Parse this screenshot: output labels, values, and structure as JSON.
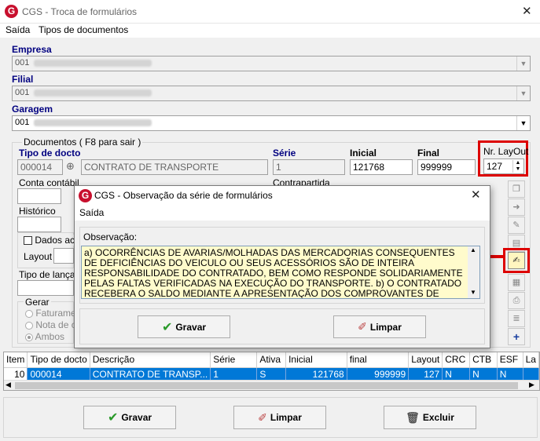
{
  "window": {
    "title": "CGS - Troca de formulários"
  },
  "menu": {
    "saida": "Saída",
    "tipos": "Tipos de documentos"
  },
  "empresa": {
    "label": "Empresa",
    "code": "001"
  },
  "filial": {
    "label": "Filial",
    "code": "001"
  },
  "garagem": {
    "label": "Garagem",
    "code": "001"
  },
  "documentos": {
    "group_title": "Documentos ( F8 para sair )",
    "tipo_docto_label": "Tipo de docto",
    "tipo_docto_code": "000014",
    "tipo_docto_desc": "CONTRATO DE TRANSPORTE",
    "serie_label": "Série",
    "serie_value": "1",
    "inicial_label": "Inicial",
    "inicial_value": "121768",
    "final_label": "Final",
    "final_value": "999999",
    "layout_label": "Nr. LayOut",
    "layout_value": "127",
    "conta_contabil_label": "Conta contábil",
    "contrapartida_label": "Contrapartida",
    "historico_label": "Histórico",
    "dados_label": "Dados ac",
    "layout_small_label": "Layout",
    "tipo_lanc_label": "Tipo de lançam",
    "gerar_label": "Gerar",
    "gerar_options": [
      "Faturamen",
      "Nota de c",
      "Ambos"
    ]
  },
  "dialog": {
    "title": "CGS - Observação da série de formulários",
    "menu_saida": "Saída",
    "obs_label": "Observação:",
    "obs_text": "a) OCORRÊNCIAS DE AVARIAS/MOLHADAS DAS MERCADORIAS CONSEQUENTES DE DEFICIÊNCIAS DO VEICULO OU SEUS ACESSÓRIOS SÃO DE INTEIRA RESPONSABILIDADE DO CONTRATADO, BEM COMO RESPONDE SOLIDARIAMENTE PELAS FALTAS VERIFICADAS NA EXECUÇÃO DO TRANSPORTE. b) O CONTRATADO RECEBERA O SALDO MEDIANTE A APRESENTAÇÃO DOS COMPROVANTES DE ENTREGAS, DEVIDAMENTE ASSINADOS,",
    "gravar": "Gravar",
    "limpar": "Limpar"
  },
  "grid": {
    "headers": [
      "Item",
      "Tipo de docto",
      "Descrição",
      "Série",
      "Ativa",
      "Inicial",
      "final",
      "Layout",
      "CRC",
      "CTB",
      "ESF",
      "La"
    ],
    "row": [
      "10",
      "000014",
      "CONTRATO DE TRANSP...",
      "1",
      "S",
      "121768",
      "999999",
      "127",
      "N",
      "N",
      "N",
      ""
    ]
  },
  "buttons": {
    "gravar": "Gravar",
    "limpar": "Limpar",
    "excluir": "Excluir"
  },
  "colors": {
    "highlight": "#dd0000",
    "selection": "#0078d7",
    "label_blue": "#000080",
    "note_bg": "#fffbcc"
  }
}
